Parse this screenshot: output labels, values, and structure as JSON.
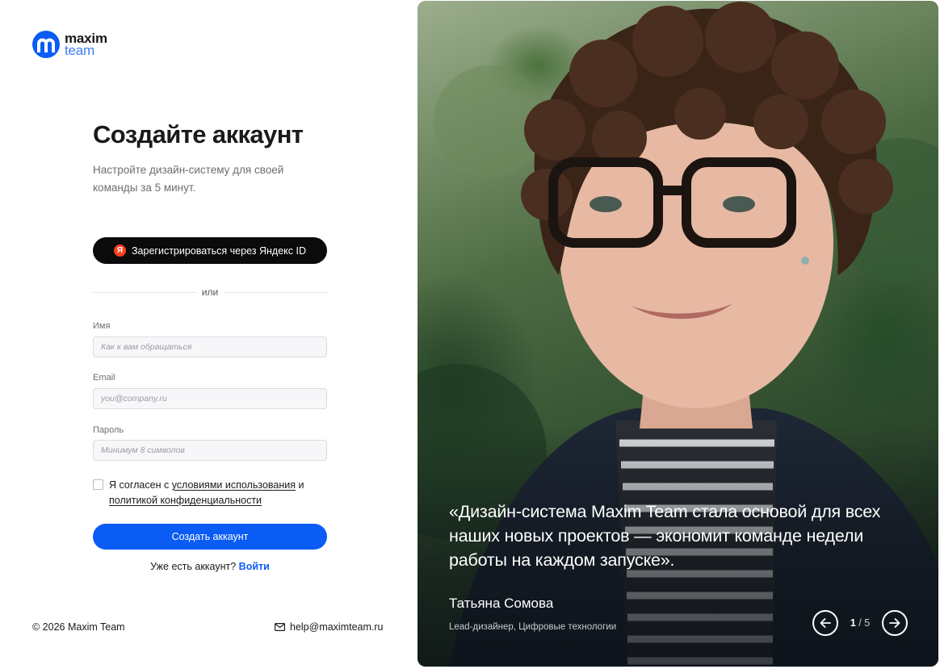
{
  "brand": {
    "logo_line1": "maxim",
    "logo_line2": "team",
    "accent_color": "#0b5cf5",
    "logo_color": "#3b7cf5"
  },
  "signup": {
    "title": "Создайте аккаунт",
    "subtitle": "Настройте дизайн-систему для своей команды за 5 минут.",
    "yandex_icon_letter": "Я",
    "yandex_button": "Зарегистрироваться через Яндекс ID",
    "divider": "или",
    "fields": {
      "name_label": "Имя",
      "name_placeholder": "Как к вам обращаться",
      "email_label": "Email",
      "email_placeholder": "you@company.ru",
      "password_label": "Пароль",
      "password_placeholder": "Минимум 8 символов"
    },
    "agree": {
      "prefix": "Я согласен с ",
      "terms_link": "условиями использования",
      "middle": " и ",
      "privacy_link": "политикой конфиденциальности"
    },
    "submit_button": "Создать аккаунт",
    "have_account": "Уже есть аккаунт?",
    "login_link": "Войти"
  },
  "footer": {
    "copyright": "© 2026 Maxim Team",
    "email": "help@maximteam.ru"
  },
  "testimonial": {
    "quote": "«Дизайн-система Maxim Team стала основой для всех наших новых проектов — экономит команде недели работы на каждом запуске».",
    "author": "Татьяна Сомова",
    "role": "Lead-дизайнер, Цифровые технологии",
    "current": "1",
    "total": "/ 5"
  }
}
